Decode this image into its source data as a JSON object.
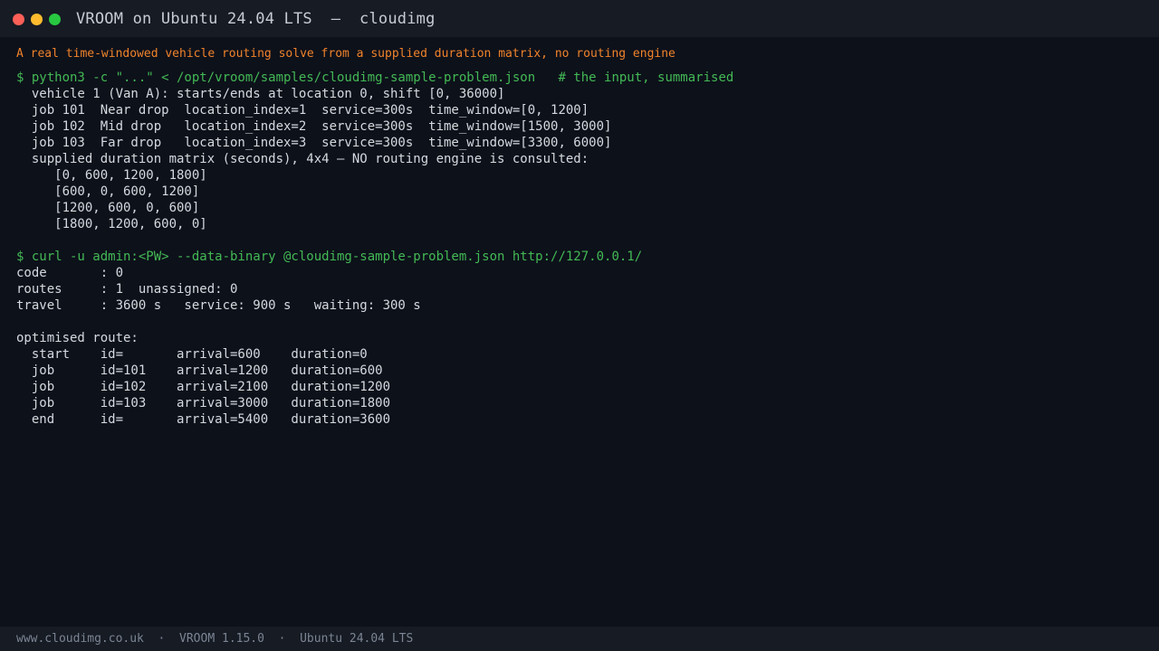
{
  "window": {
    "title": "VROOM on Ubuntu 24.04 LTS  –  cloudimg"
  },
  "terminal": {
    "subtitle": "A real time-windowed vehicle routing solve from a supplied duration matrix, no routing engine",
    "lines": [
      {
        "kind": "cmd",
        "text": "$ python3 -c \"...\" < /opt/vroom/samples/cloudimg-sample-problem.json   # the input, summarised"
      },
      {
        "kind": "out",
        "text": "  vehicle 1 (Van A): starts/ends at location 0, shift [0, 36000]"
      },
      {
        "kind": "out",
        "text": "  job 101  Near drop  location_index=1  service=300s  time_window=[0, 1200]"
      },
      {
        "kind": "out",
        "text": "  job 102  Mid drop   location_index=2  service=300s  time_window=[1500, 3000]"
      },
      {
        "kind": "out",
        "text": "  job 103  Far drop   location_index=3  service=300s  time_window=[3300, 6000]"
      },
      {
        "kind": "out",
        "text": "  supplied duration matrix (seconds), 4x4 — NO routing engine is consulted:"
      },
      {
        "kind": "out",
        "text": "     [0, 600, 1200, 1800]"
      },
      {
        "kind": "out",
        "text": "     [600, 0, 600, 1200]"
      },
      {
        "kind": "out",
        "text": "     [1200, 600, 0, 600]"
      },
      {
        "kind": "out",
        "text": "     [1800, 1200, 600, 0]"
      },
      {
        "kind": "blank",
        "text": ""
      },
      {
        "kind": "cmd",
        "text": "$ curl -u admin:<PW> --data-binary @cloudimg-sample-problem.json http://127.0.0.1/"
      },
      {
        "kind": "out",
        "text": "code       : 0"
      },
      {
        "kind": "out",
        "text": "routes     : 1  unassigned: 0"
      },
      {
        "kind": "out",
        "text": "travel     : 3600 s   service: 900 s   waiting: 300 s"
      },
      {
        "kind": "blank",
        "text": ""
      },
      {
        "kind": "out",
        "text": "optimised route:"
      },
      {
        "kind": "out",
        "text": "  start    id=       arrival=600    duration=0"
      },
      {
        "kind": "out",
        "text": "  job      id=101    arrival=1200   duration=600"
      },
      {
        "kind": "out",
        "text": "  job      id=102    arrival=2100   duration=1200"
      },
      {
        "kind": "out",
        "text": "  job      id=103    arrival=3000   duration=1800"
      },
      {
        "kind": "out",
        "text": "  end      id=       arrival=5400   duration=3600"
      }
    ]
  },
  "statusbar": {
    "website": "www.cloudimg.co.uk",
    "separator": "·",
    "version": "VROOM 1.15.0",
    "os": "Ubuntu 24.04 LTS"
  },
  "colors": {
    "background": "#0d111a",
    "titlebar": "#161b24",
    "command": "#43b955",
    "subtitle": "#f0832b",
    "output": "#d5d9df",
    "close_dot": "#fe5f57",
    "minimize_dot": "#febc2e",
    "maximize_dot": "#28c840"
  }
}
